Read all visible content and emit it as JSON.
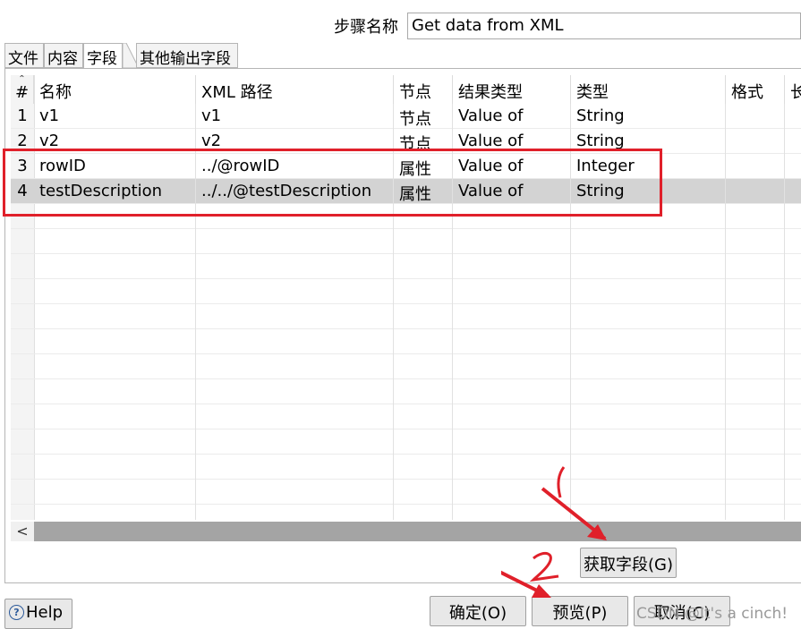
{
  "step": {
    "label": "步骤名称",
    "value": "Get data from XML"
  },
  "tabs": [
    {
      "label": "文件",
      "active": false
    },
    {
      "label": "内容",
      "active": false
    },
    {
      "label": "字段",
      "active": true
    },
    {
      "label": "其他输出字段",
      "active": false
    }
  ],
  "table": {
    "headers": [
      "#",
      "名称",
      "XML 路径",
      "节点",
      "结果类型",
      "类型",
      "格式",
      "长"
    ],
    "rows": [
      {
        "num": "1",
        "name": "v1",
        "path": "v1",
        "node": "节点",
        "result": "Value of",
        "type": "String",
        "selected": false
      },
      {
        "num": "2",
        "name": "v2",
        "path": "v2",
        "node": "节点",
        "result": "Value of",
        "type": "String",
        "selected": false
      },
      {
        "num": "3",
        "name": "rowID",
        "path": "../@rowID",
        "node": "属性",
        "result": "Value of",
        "type": "Integer",
        "selected": false
      },
      {
        "num": "4",
        "name": "testDescription",
        "path": "../../@testDescription",
        "node": "属性",
        "result": "Value of",
        "type": "String",
        "selected": true
      }
    ]
  },
  "scroll_left": "<",
  "buttons": {
    "get_fields": "获取字段(G)",
    "ok": "确定(O)",
    "preview": "预览(P)",
    "cancel": "取消(C)",
    "help": "Help"
  },
  "annotations": {
    "mark1": "1",
    "mark2": "2"
  },
  "watermark": "CSDN @It's a cinch!",
  "colors": {
    "annotation_red": "#e0202a",
    "selected_row": "#d3d3d3",
    "scrollbar": "#a4a4a4"
  }
}
